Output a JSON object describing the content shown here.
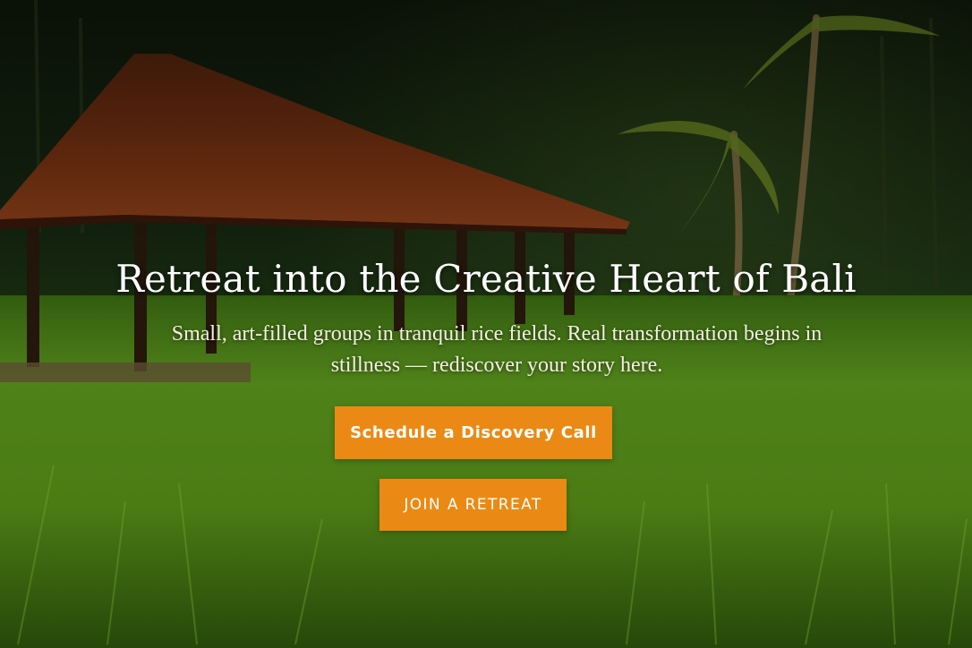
{
  "hero": {
    "title": "Retreat into the Creative Heart of Bali",
    "subtitle": "Small, art-filled groups in tranquil rice fields. Real transformation begins in stillness — rediscover your story here.",
    "primary_cta": "Schedule a Discovery Call",
    "secondary_cta": "JOIN A RETREAT",
    "background": "Bali rice field with traditional hut and palm trees"
  },
  "colors": {
    "accent": "#ea8a15",
    "title_text": "#ffffff",
    "grass": "#5a9a1c",
    "roof": "#8a3a14"
  }
}
